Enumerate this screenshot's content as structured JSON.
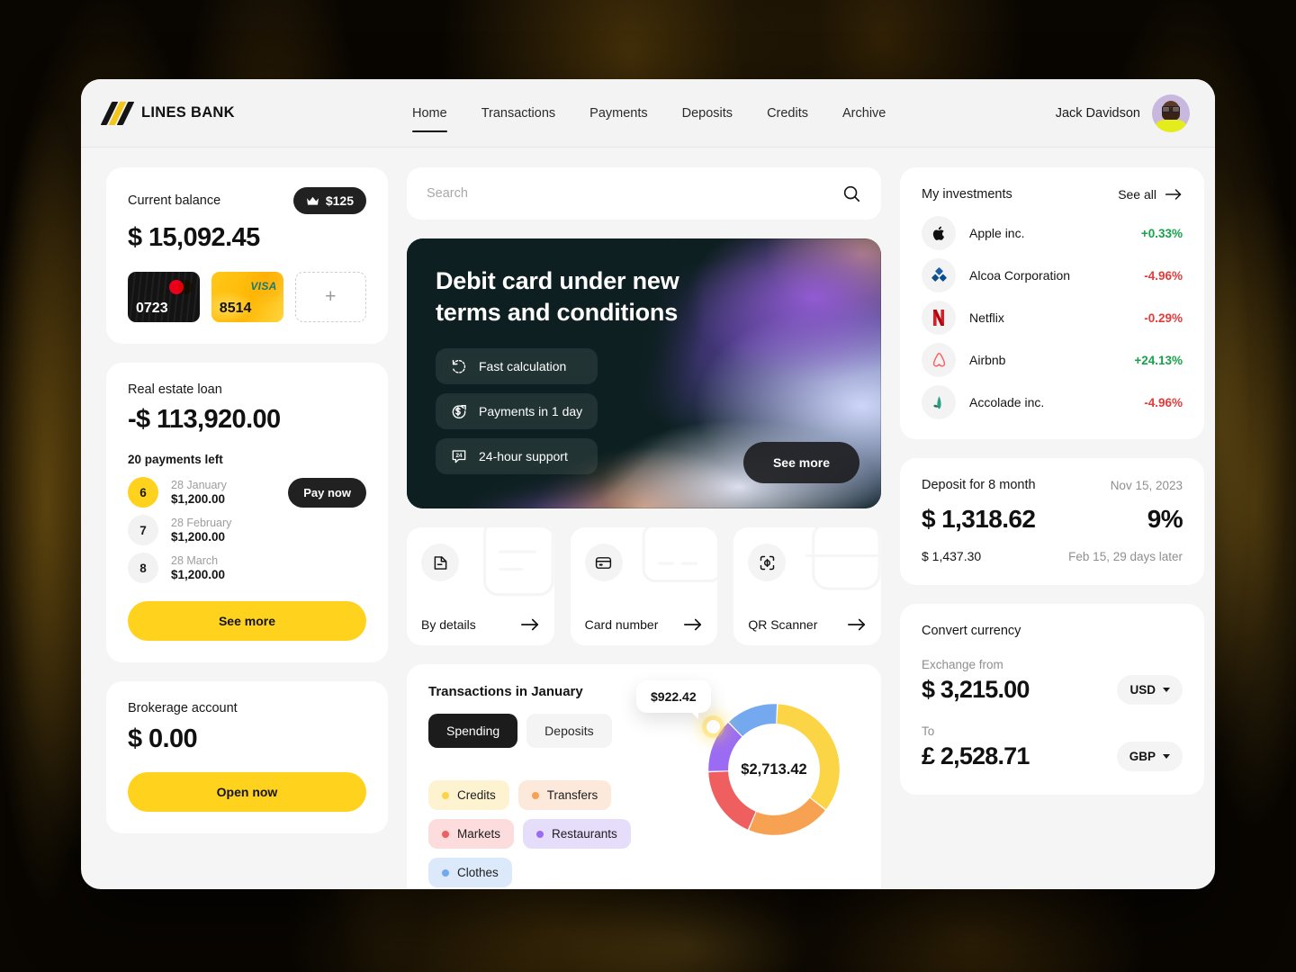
{
  "header": {
    "brand": "LINES BANK",
    "nav": [
      {
        "label": "Home",
        "active": true
      },
      {
        "label": "Transactions",
        "active": false
      },
      {
        "label": "Payments",
        "active": false
      },
      {
        "label": "Deposits",
        "active": false
      },
      {
        "label": "Credits",
        "active": false
      },
      {
        "label": "Archive",
        "active": false
      }
    ],
    "user_name": "Jack Davidson"
  },
  "balance": {
    "title": "Current balance",
    "bonus": "$125",
    "amount": "$ 15,092.45",
    "cards": [
      {
        "digits": "0723",
        "brand": "mastercard"
      },
      {
        "digits": "8514",
        "brand": "visa"
      }
    ],
    "add_label": "+"
  },
  "loan": {
    "title": "Real estate loan",
    "amount": "-$ 113,920.00",
    "payments_left": "20 payments left",
    "schedule": [
      {
        "num": "6",
        "date": "28 January",
        "amount": "$1,200.00",
        "current": true
      },
      {
        "num": "7",
        "date": "28 February",
        "amount": "$1,200.00",
        "current": false
      },
      {
        "num": "8",
        "date": "28 March",
        "amount": "$1,200.00",
        "current": false
      }
    ],
    "pay_now": "Pay now",
    "see_more": "See more"
  },
  "brokerage": {
    "title": "Brokerage account",
    "amount": "$ 0.00",
    "open_now": "Open now"
  },
  "search": {
    "placeholder": "Search",
    "value": ""
  },
  "banner": {
    "title": "Debit card under new terms and conditions",
    "features": [
      {
        "label": "Fast calculation",
        "icon": "refresh-icon"
      },
      {
        "label": "Payments in 1 day",
        "icon": "dollar-arrow-icon"
      },
      {
        "label": "24-hour support",
        "icon": "support-24-icon"
      }
    ],
    "cta": "See more"
  },
  "methods": [
    {
      "label": "By details",
      "icon": "document-icon"
    },
    {
      "label": "Card number",
      "icon": "card-icon"
    },
    {
      "label": "QR Scanner",
      "icon": "qr-scan-icon"
    }
  ],
  "transactions": {
    "title": "Transactions in January",
    "tabs": [
      {
        "label": "Spending",
        "active": true
      },
      {
        "label": "Deposits",
        "active": false
      }
    ],
    "tooltip": "$922.42"
  },
  "chart_data": {
    "type": "pie",
    "title": "Transactions in January",
    "center_label": "$2,713.42",
    "total": 2713.42,
    "legend_position": "left",
    "categories": [
      "Credits",
      "Transfers",
      "Markets",
      "Restaurants",
      "Clothes"
    ],
    "values": [
      922.42,
      570.0,
      490.0,
      365.0,
      366.0
    ],
    "degrees": [
      125,
      75,
      65,
      48,
      47
    ],
    "colors": [
      "#fbd545",
      "#f7a153",
      "#ef5f5f",
      "#9b6cf3",
      "#74a9f0"
    ],
    "chip_backgrounds": [
      "#fdf3d0",
      "#fde9dc",
      "#fcdcdc",
      "#e6ddfb",
      "#dbe9fb"
    ],
    "highlighted": {
      "category": "Credits",
      "value": "$922.42"
    }
  },
  "investments": {
    "title": "My investments",
    "see_all": "See all",
    "items": [
      {
        "name": "Apple inc.",
        "change": "+0.33%",
        "dir": "up",
        "logo": "apple-logo"
      },
      {
        "name": "Alcoa Corporation",
        "change": "-4.96%",
        "dir": "down",
        "logo": "alcoa-logo"
      },
      {
        "name": "Netflix",
        "change": "-0.29%",
        "dir": "down",
        "logo": "netflix-logo"
      },
      {
        "name": "Airbnb",
        "change": "+24.13%",
        "dir": "up",
        "logo": "airbnb-logo"
      },
      {
        "name": "Accolade inc.",
        "change": "-4.96%",
        "dir": "down",
        "logo": "accolade-logo"
      }
    ]
  },
  "deposit": {
    "title": "Deposit for 8 month",
    "date": "Nov 15, 2023",
    "amount": "$ 1,318.62",
    "rate": "9%",
    "projected": "$ 1,437.30",
    "maturity": "Feb 15, 29 days later"
  },
  "convert": {
    "title": "Convert currency",
    "from_label": "Exchange from",
    "from_amount": "$ 3,215.00",
    "from_currency": "USD",
    "to_label": "To",
    "to_amount": "£ 2,528.71",
    "to_currency": "GBP"
  }
}
